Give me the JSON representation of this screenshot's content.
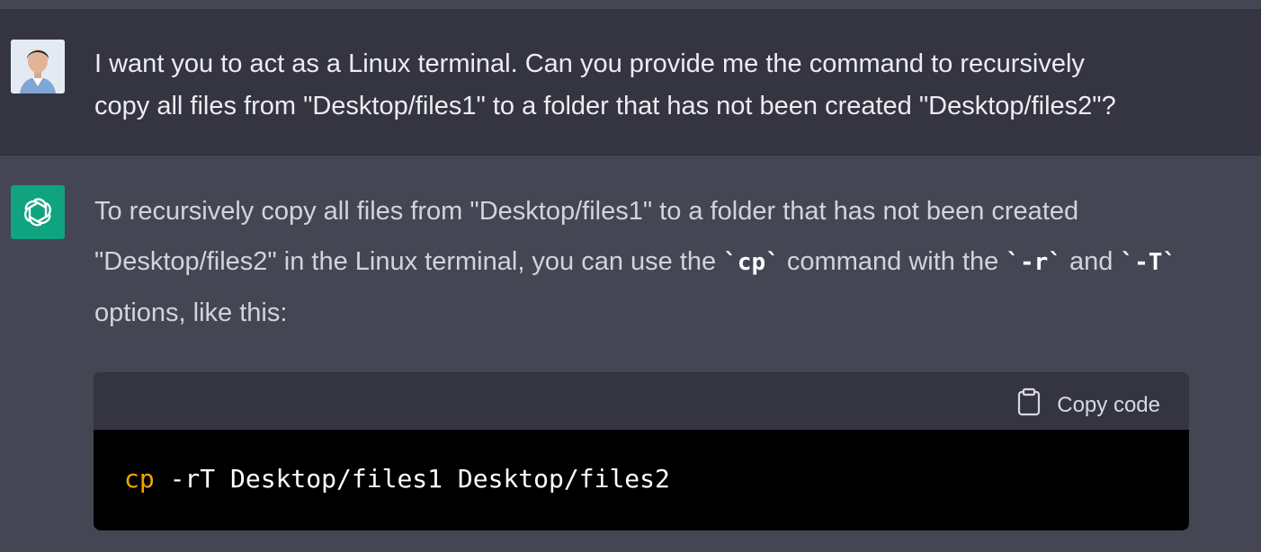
{
  "conversation": {
    "user_message": {
      "line1": "I want you to act as a Linux terminal. Can you provide me the command to recursively",
      "line2": "copy all files from \"Desktop/files1\" to a folder that has not been created \"Desktop/files2\"?"
    },
    "assistant_message": {
      "text_part1": "To recursively copy all files from \"Desktop/files1\" to a folder that has not been created \"Desktop/files2\" in the Linux terminal, you can use the ",
      "code_cp": "`cp`",
      "text_part2": " command with the ",
      "code_r": "`-r`",
      "text_part3": " and ",
      "code_T": "`-T`",
      "text_part4": " options, like this:"
    },
    "code_block": {
      "copy_label": "Copy code",
      "command": "cp",
      "args": " -rT Desktop/files1 Desktop/files2"
    }
  },
  "icons": {
    "user_avatar": "user-avatar",
    "assistant_avatar": "openai-logo-icon",
    "copy": "clipboard-icon"
  },
  "colors": {
    "user_bg": "#343541",
    "assistant_bg": "#444654",
    "assistant_avatar_bg": "#10a37f",
    "code_bg": "#000000",
    "command_color": "#f0a500"
  }
}
